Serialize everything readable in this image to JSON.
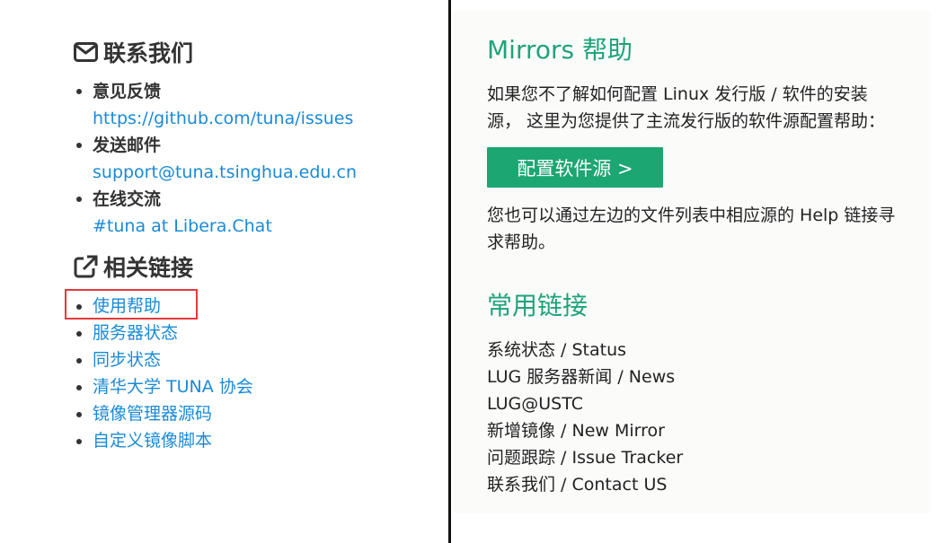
{
  "contact": {
    "title": "联系我们",
    "icon": "envelope-icon",
    "items": [
      {
        "label": "意见反馈",
        "link": "https://github.com/tuna/issues"
      },
      {
        "label": "发送邮件",
        "link": "support@tuna.tsinghua.edu.cn"
      },
      {
        "label": "在线交流",
        "link": "#tuna at Libera.Chat"
      }
    ]
  },
  "related": {
    "title": "相关链接",
    "icon": "external-link-icon",
    "items": [
      "使用帮助",
      "服务器状态",
      "同步状态",
      "清华大学 TUNA 协会",
      "镜像管理器源码",
      "自定义镜像脚本"
    ]
  },
  "mirrors_help": {
    "title": "Mirrors 帮助",
    "intro": "如果您不了解如何配置 Linux 发行版 / 软件的安装源， 这里为您提供了主流发行版的软件源配置帮助：",
    "button": "配置软件源 >",
    "outro": "您也可以通过左边的文件列表中相应源的 Help 链接寻求帮助。"
  },
  "common_links": {
    "title": "常用链接",
    "items": [
      "系统状态 / Status",
      "LUG 服务器新闻 / News",
      "LUG@USTC",
      "新增镜像 / New Mirror",
      "问题跟踪 / Issue Tracker",
      "联系我们 / Contact US"
    ]
  },
  "colors": {
    "link": "#1a8ad6",
    "accent_green": "#1fa37a",
    "button_bg": "#1ba672",
    "highlight": "#e23a3a"
  }
}
